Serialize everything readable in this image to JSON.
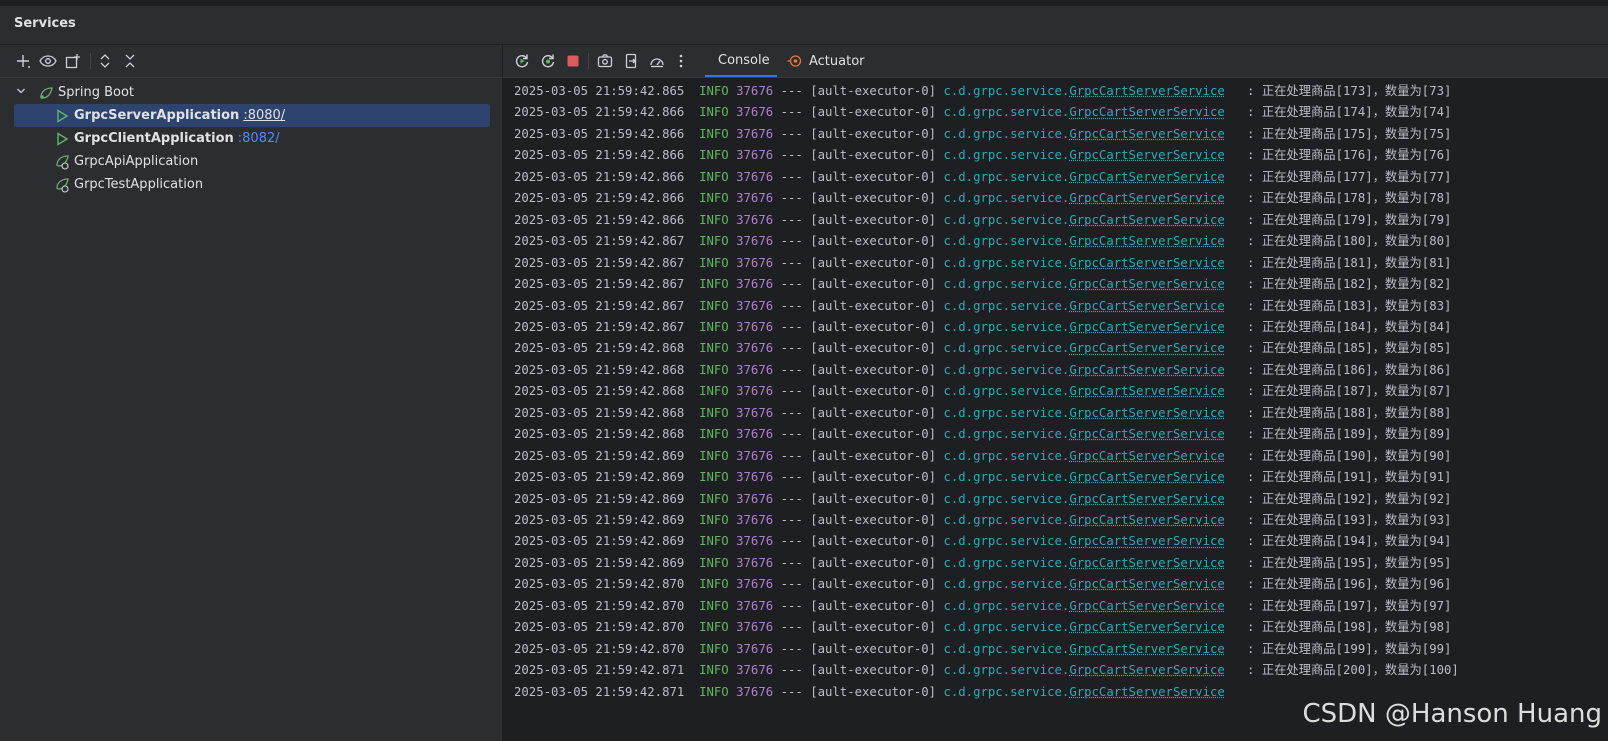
{
  "panel": {
    "title": "Services"
  },
  "left_toolbar": {
    "icons": [
      "add-icon",
      "eye-icon",
      "new-group-icon",
      "expand-all-icon",
      "collapse-all-icon"
    ]
  },
  "tree": {
    "group": "Spring Boot",
    "apps": [
      {
        "name": "GrpcServerApplication",
        "port": ":8080/",
        "running": true,
        "selected": true
      },
      {
        "name": "GrpcClientApplication",
        "port": ":8082/",
        "running": true,
        "selected": false
      },
      {
        "name": "GrpcApiApplication",
        "port": "",
        "running": false,
        "selected": false
      },
      {
        "name": "GrpcTestApplication",
        "port": "",
        "running": false,
        "selected": false
      }
    ]
  },
  "right_toolbar": {
    "icons": [
      "rerun-icon",
      "rerun-debug-icon",
      "stop-icon",
      "screenshot-icon",
      "exit-icon",
      "performance-icon",
      "more-icon"
    ],
    "tabs": [
      {
        "label": "Console",
        "active": true
      },
      {
        "label": "Actuator",
        "active": false
      }
    ]
  },
  "console": {
    "lines": [
      {
        "ts": "2025-03-05 21:59:42.865",
        "level": "INFO",
        "pid": "37676",
        "sep": "---",
        "thread": "[ault-executor-0]",
        "pkg": "c.d.grpc.service.",
        "cls": "GrpcCartServerService",
        "msg": ": 正在处理商品[173]，数量为[73]"
      },
      {
        "ts": "2025-03-05 21:59:42.866",
        "level": "INFO",
        "pid": "37676",
        "sep": "---",
        "thread": "[ault-executor-0]",
        "pkg": "c.d.grpc.service.",
        "cls": "GrpcCartServerService",
        "msg": ": 正在处理商品[174]，数量为[74]"
      },
      {
        "ts": "2025-03-05 21:59:42.866",
        "level": "INFO",
        "pid": "37676",
        "sep": "---",
        "thread": "[ault-executor-0]",
        "pkg": "c.d.grpc.service.",
        "cls": "GrpcCartServerService",
        "msg": ": 正在处理商品[175]，数量为[75]"
      },
      {
        "ts": "2025-03-05 21:59:42.866",
        "level": "INFO",
        "pid": "37676",
        "sep": "---",
        "thread": "[ault-executor-0]",
        "pkg": "c.d.grpc.service.",
        "cls": "GrpcCartServerService",
        "msg": ": 正在处理商品[176]，数量为[76]"
      },
      {
        "ts": "2025-03-05 21:59:42.866",
        "level": "INFO",
        "pid": "37676",
        "sep": "---",
        "thread": "[ault-executor-0]",
        "pkg": "c.d.grpc.service.",
        "cls": "GrpcCartServerService",
        "msg": ": 正在处理商品[177]，数量为[77]"
      },
      {
        "ts": "2025-03-05 21:59:42.866",
        "level": "INFO",
        "pid": "37676",
        "sep": "---",
        "thread": "[ault-executor-0]",
        "pkg": "c.d.grpc.service.",
        "cls": "GrpcCartServerService",
        "msg": ": 正在处理商品[178]，数量为[78]"
      },
      {
        "ts": "2025-03-05 21:59:42.866",
        "level": "INFO",
        "pid": "37676",
        "sep": "---",
        "thread": "[ault-executor-0]",
        "pkg": "c.d.grpc.service.",
        "cls": "GrpcCartServerService",
        "msg": ": 正在处理商品[179]，数量为[79]"
      },
      {
        "ts": "2025-03-05 21:59:42.867",
        "level": "INFO",
        "pid": "37676",
        "sep": "---",
        "thread": "[ault-executor-0]",
        "pkg": "c.d.grpc.service.",
        "cls": "GrpcCartServerService",
        "msg": ": 正在处理商品[180]，数量为[80]"
      },
      {
        "ts": "2025-03-05 21:59:42.867",
        "level": "INFO",
        "pid": "37676",
        "sep": "---",
        "thread": "[ault-executor-0]",
        "pkg": "c.d.grpc.service.",
        "cls": "GrpcCartServerService",
        "msg": ": 正在处理商品[181]，数量为[81]"
      },
      {
        "ts": "2025-03-05 21:59:42.867",
        "level": "INFO",
        "pid": "37676",
        "sep": "---",
        "thread": "[ault-executor-0]",
        "pkg": "c.d.grpc.service.",
        "cls": "GrpcCartServerService",
        "msg": ": 正在处理商品[182]，数量为[82]"
      },
      {
        "ts": "2025-03-05 21:59:42.867",
        "level": "INFO",
        "pid": "37676",
        "sep": "---",
        "thread": "[ault-executor-0]",
        "pkg": "c.d.grpc.service.",
        "cls": "GrpcCartServerService",
        "msg": ": 正在处理商品[183]，数量为[83]"
      },
      {
        "ts": "2025-03-05 21:59:42.867",
        "level": "INFO",
        "pid": "37676",
        "sep": "---",
        "thread": "[ault-executor-0]",
        "pkg": "c.d.grpc.service.",
        "cls": "GrpcCartServerService",
        "msg": ": 正在处理商品[184]，数量为[84]"
      },
      {
        "ts": "2025-03-05 21:59:42.868",
        "level": "INFO",
        "pid": "37676",
        "sep": "---",
        "thread": "[ault-executor-0]",
        "pkg": "c.d.grpc.service.",
        "cls": "GrpcCartServerService",
        "msg": ": 正在处理商品[185]，数量为[85]"
      },
      {
        "ts": "2025-03-05 21:59:42.868",
        "level": "INFO",
        "pid": "37676",
        "sep": "---",
        "thread": "[ault-executor-0]",
        "pkg": "c.d.grpc.service.",
        "cls": "GrpcCartServerService",
        "msg": ": 正在处理商品[186]，数量为[86]"
      },
      {
        "ts": "2025-03-05 21:59:42.868",
        "level": "INFO",
        "pid": "37676",
        "sep": "---",
        "thread": "[ault-executor-0]",
        "pkg": "c.d.grpc.service.",
        "cls": "GrpcCartServerService",
        "msg": ": 正在处理商品[187]，数量为[87]"
      },
      {
        "ts": "2025-03-05 21:59:42.868",
        "level": "INFO",
        "pid": "37676",
        "sep": "---",
        "thread": "[ault-executor-0]",
        "pkg": "c.d.grpc.service.",
        "cls": "GrpcCartServerService",
        "msg": ": 正在处理商品[188]，数量为[88]"
      },
      {
        "ts": "2025-03-05 21:59:42.868",
        "level": "INFO",
        "pid": "37676",
        "sep": "---",
        "thread": "[ault-executor-0]",
        "pkg": "c.d.grpc.service.",
        "cls": "GrpcCartServerService",
        "msg": ": 正在处理商品[189]，数量为[89]"
      },
      {
        "ts": "2025-03-05 21:59:42.869",
        "level": "INFO",
        "pid": "37676",
        "sep": "---",
        "thread": "[ault-executor-0]",
        "pkg": "c.d.grpc.service.",
        "cls": "GrpcCartServerService",
        "msg": ": 正在处理商品[190]，数量为[90]"
      },
      {
        "ts": "2025-03-05 21:59:42.869",
        "level": "INFO",
        "pid": "37676",
        "sep": "---",
        "thread": "[ault-executor-0]",
        "pkg": "c.d.grpc.service.",
        "cls": "GrpcCartServerService",
        "msg": ": 正在处理商品[191]，数量为[91]"
      },
      {
        "ts": "2025-03-05 21:59:42.869",
        "level": "INFO",
        "pid": "37676",
        "sep": "---",
        "thread": "[ault-executor-0]",
        "pkg": "c.d.grpc.service.",
        "cls": "GrpcCartServerService",
        "msg": ": 正在处理商品[192]，数量为[92]"
      },
      {
        "ts": "2025-03-05 21:59:42.869",
        "level": "INFO",
        "pid": "37676",
        "sep": "---",
        "thread": "[ault-executor-0]",
        "pkg": "c.d.grpc.service.",
        "cls": "GrpcCartServerService",
        "msg": ": 正在处理商品[193]，数量为[93]"
      },
      {
        "ts": "2025-03-05 21:59:42.869",
        "level": "INFO",
        "pid": "37676",
        "sep": "---",
        "thread": "[ault-executor-0]",
        "pkg": "c.d.grpc.service.",
        "cls": "GrpcCartServerService",
        "msg": ": 正在处理商品[194]，数量为[94]"
      },
      {
        "ts": "2025-03-05 21:59:42.869",
        "level": "INFO",
        "pid": "37676",
        "sep": "---",
        "thread": "[ault-executor-0]",
        "pkg": "c.d.grpc.service.",
        "cls": "GrpcCartServerService",
        "msg": ": 正在处理商品[195]，数量为[95]"
      },
      {
        "ts": "2025-03-05 21:59:42.870",
        "level": "INFO",
        "pid": "37676",
        "sep": "---",
        "thread": "[ault-executor-0]",
        "pkg": "c.d.grpc.service.",
        "cls": "GrpcCartServerService",
        "msg": ": 正在处理商品[196]，数量为[96]"
      },
      {
        "ts": "2025-03-05 21:59:42.870",
        "level": "INFO",
        "pid": "37676",
        "sep": "---",
        "thread": "[ault-executor-0]",
        "pkg": "c.d.grpc.service.",
        "cls": "GrpcCartServerService",
        "msg": ": 正在处理商品[197]，数量为[97]"
      },
      {
        "ts": "2025-03-05 21:59:42.870",
        "level": "INFO",
        "pid": "37676",
        "sep": "---",
        "thread": "[ault-executor-0]",
        "pkg": "c.d.grpc.service.",
        "cls": "GrpcCartServerService",
        "msg": ": 正在处理商品[198]，数量为[98]"
      },
      {
        "ts": "2025-03-05 21:59:42.870",
        "level": "INFO",
        "pid": "37676",
        "sep": "---",
        "thread": "[ault-executor-0]",
        "pkg": "c.d.grpc.service.",
        "cls": "GrpcCartServerService",
        "msg": ": 正在处理商品[199]，数量为[99]"
      },
      {
        "ts": "2025-03-05 21:59:42.871",
        "level": "INFO",
        "pid": "37676",
        "sep": "---",
        "thread": "[ault-executor-0]",
        "pkg": "c.d.grpc.service.",
        "cls": "GrpcCartServerService",
        "msg": ": 正在处理商品[200]，数量为[100]"
      },
      {
        "ts": "2025-03-05 21:59:42.871",
        "level": "INFO",
        "pid": "37676",
        "sep": "---",
        "thread": "[ault-executor-0]",
        "pkg": "c.d.grpc.service.",
        "cls": "GrpcCartServerService",
        "msg": ""
      }
    ]
  },
  "watermark": "CSDN @Hanson Huang",
  "colors": {
    "accent": "#3574f0",
    "selection": "#2e436e",
    "info": "#5fb85b",
    "pid": "#b07fd0",
    "class": "#2aacb8",
    "link": "#548af7",
    "stop": "#db5c5c",
    "run": "#5fb865"
  }
}
